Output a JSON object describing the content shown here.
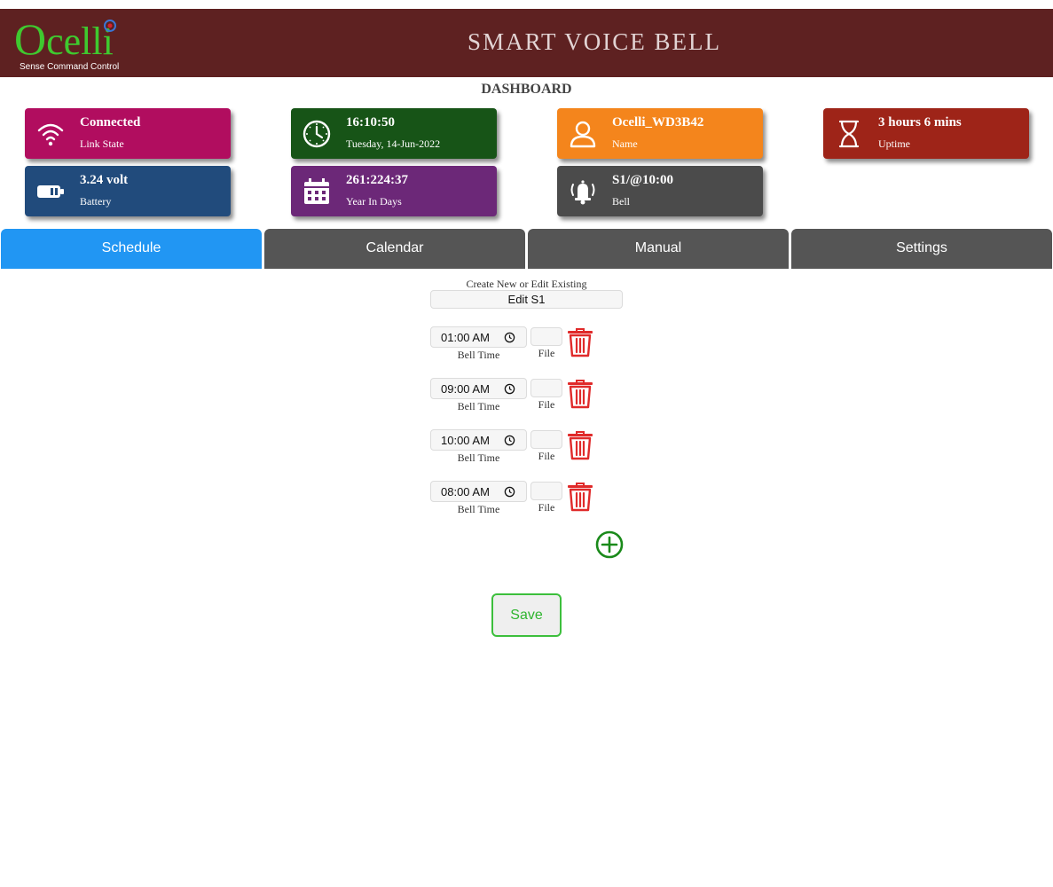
{
  "header": {
    "logo_text": "Ocelli",
    "logo_tagline": "Sense Command Control",
    "title": "SMART VOICE BELL"
  },
  "dashboard": {
    "title": "DASHBOARD",
    "cards": [
      {
        "value": "Connected",
        "label": "Link State",
        "icon": "wifi-icon",
        "color": "#b10d5f"
      },
      {
        "value": "16:10:50",
        "label": "Tuesday, 14-Jun-2022",
        "icon": "clock-icon",
        "color": "#175417"
      },
      {
        "value": "Ocelli_WD3B42",
        "label": "Name",
        "icon": "user-icon",
        "color": "#f4851c"
      },
      {
        "value": "3 hours 6 mins",
        "label": "Uptime",
        "icon": "hourglass-icon",
        "color": "#9e2418"
      },
      {
        "value": "3.24 volt",
        "label": "Battery",
        "icon": "battery-icon",
        "color": "#214b7c"
      },
      {
        "value": "261:224:37",
        "label": "Year In Days",
        "icon": "calendar-icon",
        "color": "#6c2878"
      },
      {
        "value": "S1/@10:00",
        "label": "Bell",
        "icon": "bell-icon",
        "color": "#4b4b4b"
      }
    ]
  },
  "tabs": [
    {
      "label": "Schedule",
      "active": true
    },
    {
      "label": "Calendar",
      "active": false
    },
    {
      "label": "Manual",
      "active": false
    },
    {
      "label": "Settings",
      "active": false
    }
  ],
  "schedule": {
    "caption": "Create New or Edit Existing",
    "selected": "Edit S1",
    "rows": [
      {
        "time": "01:00 AM",
        "time_label": "Bell Time",
        "file": "",
        "file_label": "File"
      },
      {
        "time": "09:00 AM",
        "time_label": "Bell Time",
        "file": "",
        "file_label": "File"
      },
      {
        "time": "10:00 AM",
        "time_label": "Bell Time",
        "file": "",
        "file_label": "File"
      },
      {
        "time": "08:00 AM",
        "time_label": "Bell Time",
        "file": "",
        "file_label": "File"
      }
    ],
    "save_label": "Save"
  },
  "colors": {
    "header_bg": "#5e2121",
    "logo_green": "#3fc92f",
    "tab_active": "#2196f3",
    "tab_inactive": "#555555",
    "delete_red": "#e02a2a",
    "add_green": "#1a8a1a",
    "save_green": "#3cbf3c"
  }
}
